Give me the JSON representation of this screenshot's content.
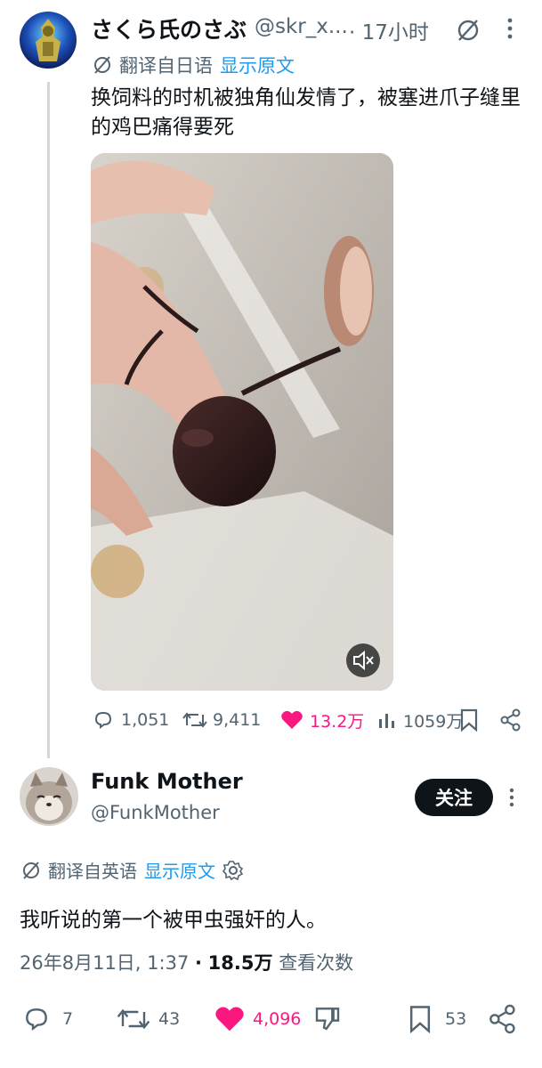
{
  "tweet": {
    "author_name": "さくら氏のさぶ",
    "author_handle": "@skr_x...",
    "time": "· 17小时",
    "translated_label": "翻译自日语",
    "show_original": "显示原文",
    "text": "换饲料的时机被独角仙发情了，被塞进爪子缝里的鸡巴痛得要死",
    "stats": {
      "replies": "1,051",
      "retweets": "9,411",
      "likes": "13.2万",
      "views": "1059万"
    },
    "like_color": "#f91880"
  },
  "reply": {
    "author_name": "Funk Mother",
    "author_handle": "@FunkMother",
    "follow_label": "关注",
    "translated_label": "翻译自英语",
    "show_original": "显示原文",
    "text": "我听说的第一个被甲虫强奸的人。",
    "date": "26年8月11日, 1:37",
    "dot": "·",
    "views": "18.5万",
    "views_label": "查看次数",
    "stats": {
      "replies": "7",
      "retweets": "43",
      "likes": "4,096",
      "bookmarks": "53"
    }
  },
  "colors": {
    "text": "#0f1419",
    "secondary": "#536471",
    "link": "#1d9bf0",
    "like": "#f91880"
  }
}
